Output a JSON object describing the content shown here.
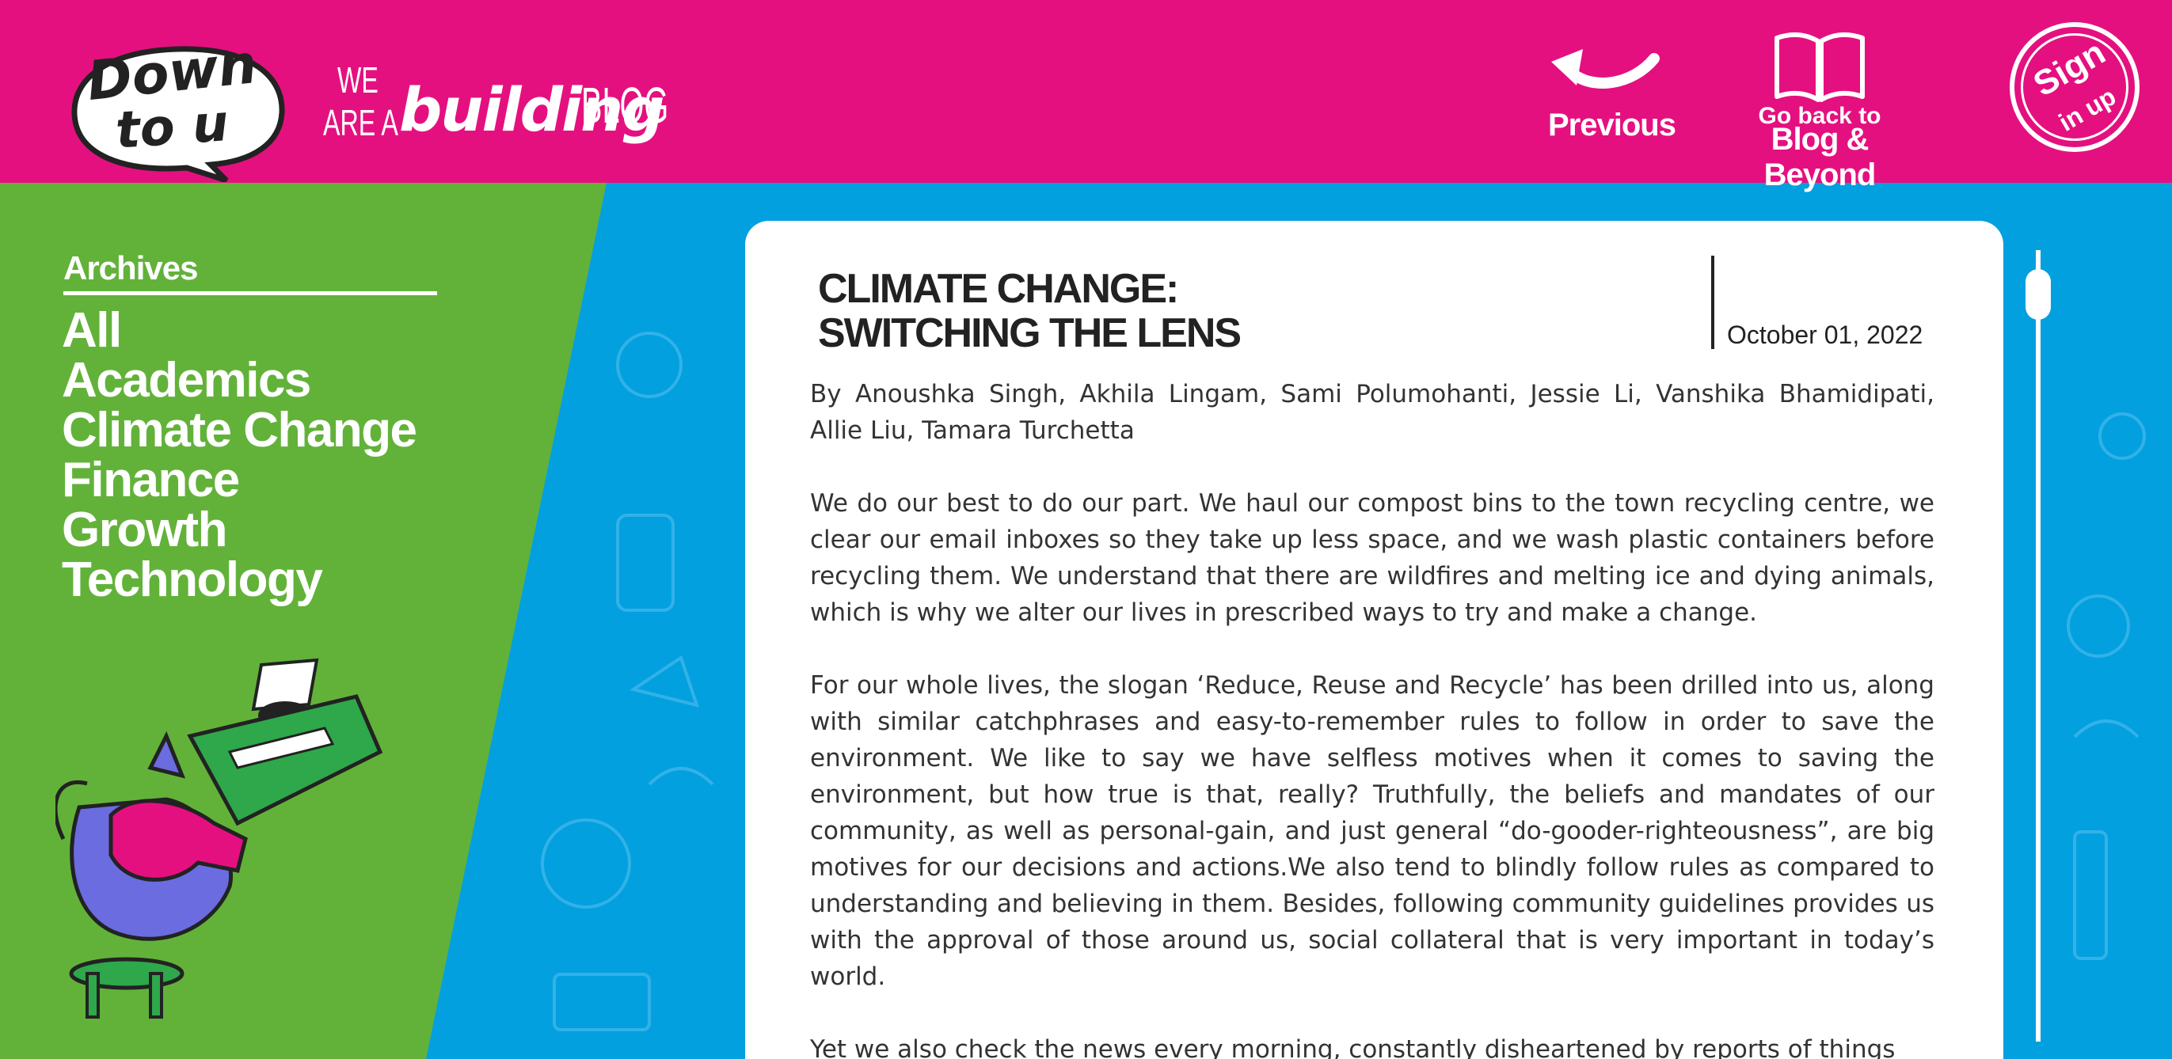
{
  "brand": {
    "logo_line1": "Down",
    "logo_line2": "to u",
    "tagline_we": "WE",
    "tagline_area": "ARE A",
    "tagline_building": "building",
    "tagline_blog": "BLOG"
  },
  "nav": {
    "previous_label": "Previous",
    "back_line1": "Go back to",
    "back_line2": "Blog & Beyond",
    "signup_line1": "Sign",
    "signup_line2": "in up"
  },
  "sidebar": {
    "title": "Archives",
    "items": [
      {
        "label": "All"
      },
      {
        "label": "Academics"
      },
      {
        "label": "Climate Change"
      },
      {
        "label": "Finance"
      },
      {
        "label": "Growth"
      },
      {
        "label": "Technology"
      }
    ]
  },
  "article": {
    "title_line1": "CLIMATE CHANGE:",
    "title_line2": "SWITCHING THE LENS",
    "date": "October 01, 2022",
    "byline": "By Anoushka Singh, Akhila Lingam, Sami Polumohanti, Jessie Li, Vanshika Bhamidipati, Allie Liu, Tamara Turchetta",
    "paragraphs": [
      "We do our best to do our part. We haul our compost bins to the town recycling centre, we clear our email inboxes so they take up less space, and we wash plastic containers before recycling them. We understand that there are wildfires and melting ice and dying animals, which is why we alter our lives in prescribed ways to try and make a change.",
      "For our whole lives, the slogan ‘Reduce, Reuse and Recycle’ has been drilled into us, along with similar catchphrases and easy-to-remember rules to follow in order to save the environment. We like to say we have selfless motives when it comes to saving the environment, but how true is that, really? Truthfully, the beliefs and mandates of our community, as well as personal-gain, and just general “do-gooder-righteousness”, are big motives for our decisions and actions.We also tend to blindly follow rules as compared to understanding and believing in them. Besides, following community guidelines provides us with the approval of those around us, social collateral that is very important in today’s world.",
      "Yet we also check the news every morning, constantly disheartened by reports of things"
    ]
  },
  "colors": {
    "header": "#e5107f",
    "sidebar": "#62b23a",
    "background": "#03a0e0",
    "card": "#ffffff"
  }
}
